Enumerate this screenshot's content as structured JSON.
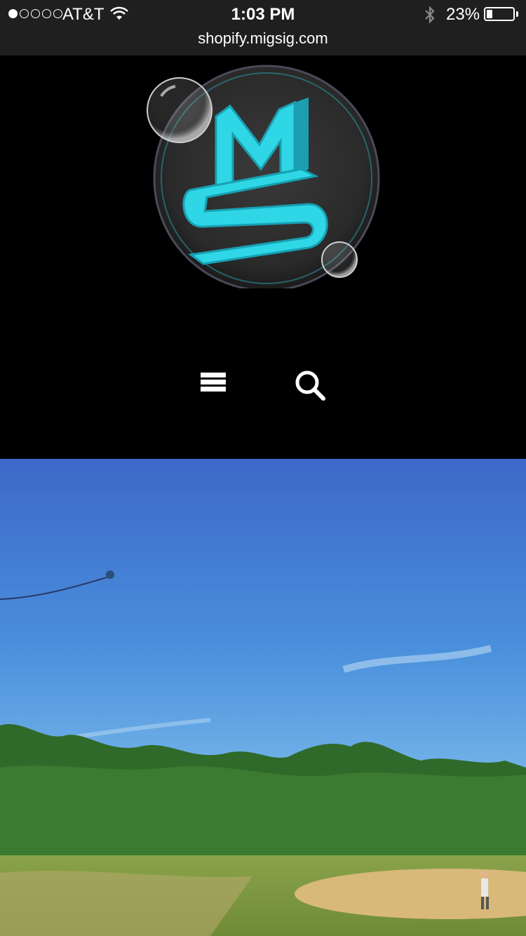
{
  "status_bar": {
    "carrier": "AT&T",
    "time": "1:03 PM",
    "battery_percent": "23%",
    "battery_level": 0.23,
    "signal_bars_filled": 1,
    "signal_bars_total": 5
  },
  "browser": {
    "url": "shopify.migsig.com"
  },
  "header": {
    "logo_letters": "MS",
    "menu_icon": "hamburger-menu-icon",
    "search_icon": "search-icon",
    "accent_color": "#2fd6e6"
  },
  "hero": {
    "image_description_icon": "kite-field-photo"
  }
}
